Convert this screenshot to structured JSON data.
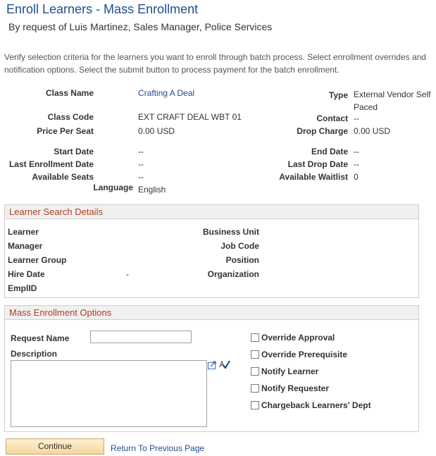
{
  "page": {
    "title": "Enroll Learners - Mass Enrollment",
    "subtitle": "By request of Luis Martinez, Sales Manager, Police Services",
    "instructions": "Verify selection criteria for the learners you want to enroll through batch process. Select enrollment overrides and notification options. Select the submit button to process payment for the batch enrollment."
  },
  "class_info": {
    "class_name_label": "Class Name",
    "class_name": "Crafting A Deal",
    "type_label": "Type",
    "type_value": "External Vendor Self Paced",
    "class_code_label": "Class Code",
    "class_code": "EXT CRAFT DEAL WBT 01",
    "contact_label": "Contact",
    "contact_value": "--",
    "price_label": "Price Per Seat",
    "price_value": "0.00 USD",
    "drop_charge_label": "Drop Charge",
    "drop_charge_value": "0.00 USD",
    "start_date_label": "Start Date",
    "start_date_value": "--",
    "end_date_label": "End Date",
    "end_date_value": "--",
    "last_enroll_label": "Last Enrollment Date",
    "last_enroll_value": "--",
    "last_drop_label": "Last Drop Date",
    "last_drop_value": "--",
    "avail_seats_label": "Available Seats",
    "avail_seats_value": "--",
    "avail_waitlist_label": "Available Waitlist",
    "avail_waitlist_value": "0",
    "language_label": "Language",
    "language_value": "English"
  },
  "learner_search": {
    "header": "Learner Search Details",
    "learner_label": "Learner",
    "manager_label": "Manager",
    "learner_group_label": "Learner Group",
    "hire_date_label": "Hire Date",
    "hire_date_value": "-",
    "emplid_label": "EmplID",
    "business_unit_label": "Business Unit",
    "job_code_label": "Job Code",
    "position_label": "Position",
    "organization_label": "Organization"
  },
  "mass_options": {
    "header": "Mass Enrollment Options",
    "request_name_label": "Request Name",
    "request_name_value": "",
    "description_label": "Description",
    "description_value": "",
    "checkboxes": [
      {
        "label": "Override Approval",
        "checked": false
      },
      {
        "label": "Override Prerequisite",
        "checked": false
      },
      {
        "label": "Notify Learner",
        "checked": false
      },
      {
        "label": "Notify Requester",
        "checked": false
      },
      {
        "label": "Chargeback Learners' Dept",
        "checked": false
      }
    ]
  },
  "footer": {
    "continue_label": "Continue",
    "return_label": "Return To Previous Page"
  },
  "colors": {
    "title": "#1f4e8c",
    "section_header_text": "#b13d22",
    "link": "#1f4e8c"
  }
}
